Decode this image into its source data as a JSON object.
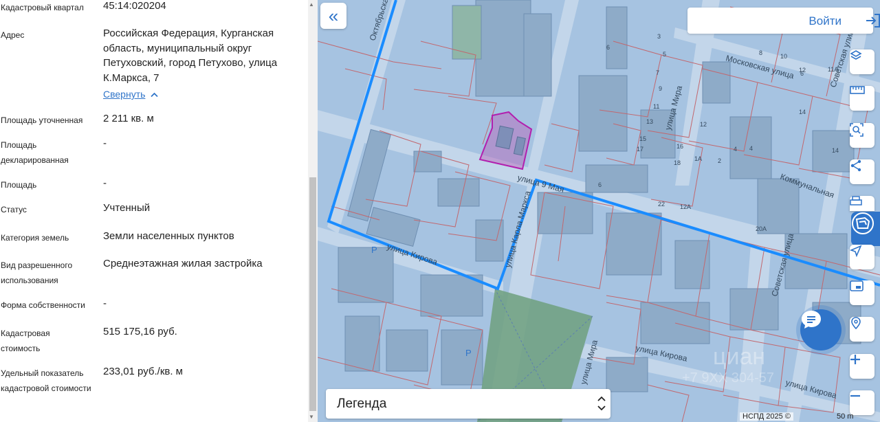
{
  "panel": {
    "rows": [
      {
        "id": "cadastral-quarter",
        "label": "Кадастровый квартал",
        "value": "45:14:020204"
      },
      {
        "id": "address",
        "label": "Адрес",
        "value": "Российская Федерация, Курганская область, муниципальный округ Петуховский, город Петухово, улица К.Маркса, 7"
      },
      {
        "id": "area-refined",
        "label": "Площадь уточненная",
        "value": "2 211 кв. м"
      },
      {
        "id": "area-declared",
        "label": "Площадь декларированная",
        "value": "-"
      },
      {
        "id": "area",
        "label": "Площадь",
        "value": "-"
      },
      {
        "id": "status",
        "label": "Статус",
        "value": "Учтенный"
      },
      {
        "id": "land-category",
        "label": "Категория земель",
        "value": "Земли населенных пунктов"
      },
      {
        "id": "permitted-use",
        "label": "Вид разрешенного использования",
        "value": "Среднеэтажная жилая застройка"
      },
      {
        "id": "ownership-form",
        "label": "Форма собственности",
        "value": "-"
      },
      {
        "id": "cadastral-value",
        "label": "Кадастровая стоимость",
        "value": "515 175,16 руб."
      },
      {
        "id": "specific-value",
        "label": "Удельный показатель кадастровой стоимости",
        "value": "233,01 руб./кв. м"
      }
    ],
    "collapse_label": "Свернуть"
  },
  "map": {
    "login_label": "Войти",
    "legend_label": "Легенда",
    "attribution": "НСПД 2025 ©",
    "scale_label": "50 m",
    "streets": {
      "oktyabrskaya": "Октябрьская",
      "moskovskaya": "Московская улица",
      "sovetskaya_top": "Советская улица",
      "mira_top": "улица Мира",
      "may9": "улица 9 Мая",
      "kommunalnaya": "Коммунальная",
      "karla_marksa": "улица Карла Маркса",
      "kirova_left": "улица Кирова",
      "kirova_mid": "улица Кирова",
      "kirova_right": "улица Кирова",
      "sovetskaya_mid": "Советская улица",
      "mira_bottom": "улица Мира"
    },
    "house_numbers": [
      "6",
      "5",
      "3",
      "7",
      "9",
      "11",
      "13",
      "15",
      "8",
      "10",
      "12",
      "14",
      "16",
      "18",
      "17",
      "2",
      "4",
      "6",
      "12",
      "14",
      "22",
      "12А",
      "20А",
      "4",
      "6",
      "11А",
      "1А"
    ],
    "parking_label": "P",
    "watermark": "циан",
    "watermark_phone": "+7 9ХХ 304-57",
    "side_tools": [
      "layers-icon",
      "ruler-icon",
      "search-area-icon",
      "share-icon",
      "print-icon",
      "locate-icon",
      "minimap-icon",
      "pin-search-icon",
      "zoom-in-icon",
      "zoom-out-icon"
    ],
    "colors": {
      "accent": "#2f74c9",
      "selected_parcel": "#b21fae",
      "quarter_border": "#1a8cff",
      "parcel_lines": "#c2676e",
      "map_overlay": "#a9c6e3"
    }
  }
}
